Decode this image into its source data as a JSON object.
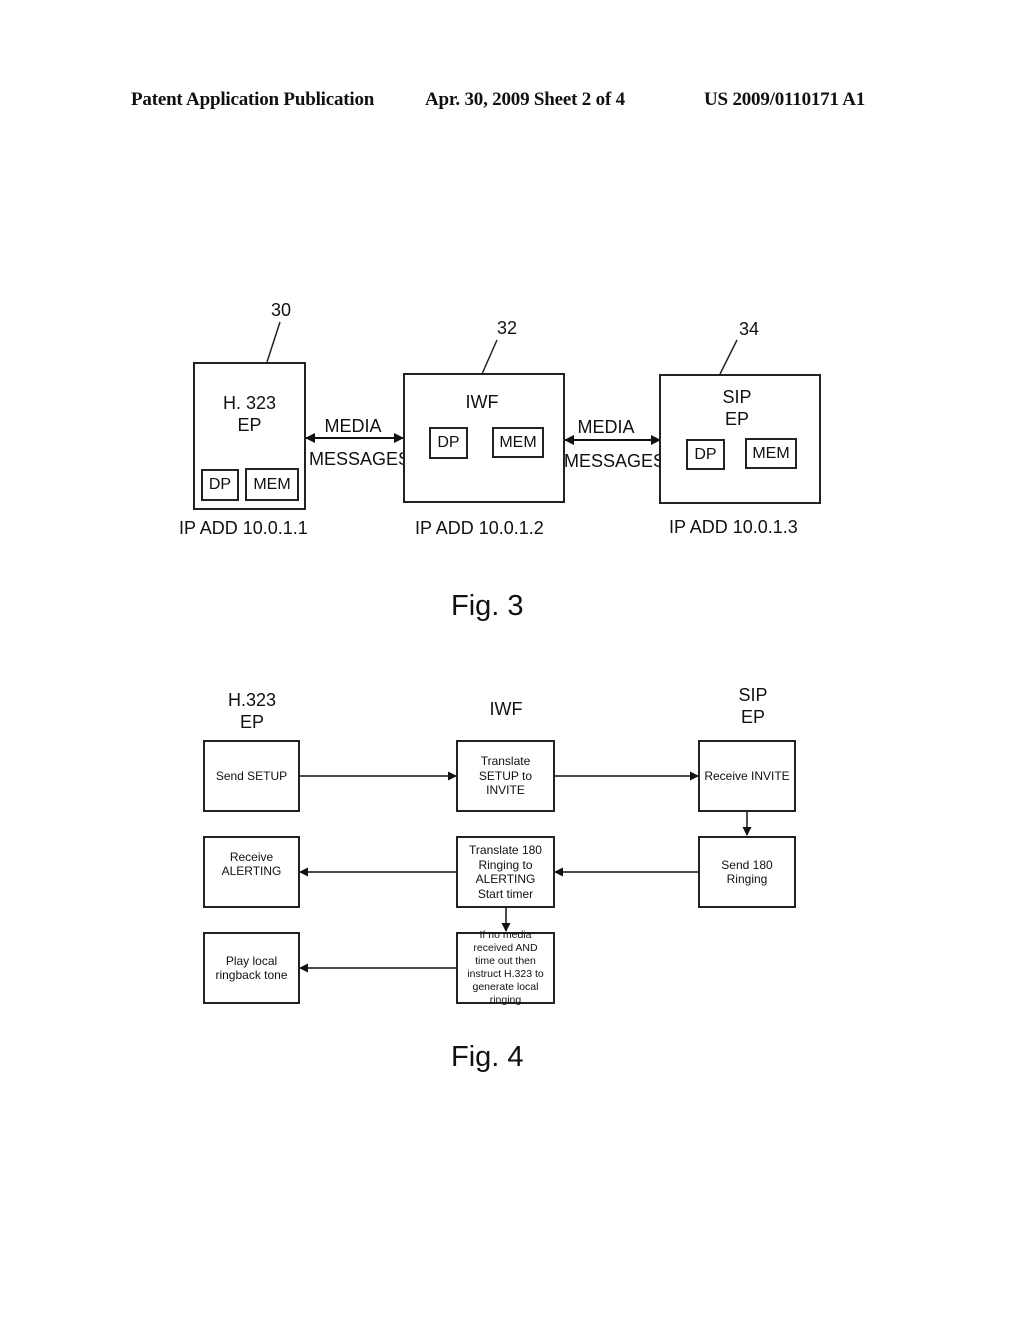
{
  "header": {
    "left": "Patent Application Publication",
    "center": "Apr. 30, 2009  Sheet 2 of 4",
    "right": "US 2009/0110171 A1"
  },
  "fig3": {
    "caption": "Fig. 3",
    "nodes": [
      {
        "ref": "30",
        "title": "H. 323\nEP",
        "dp": "DP",
        "mem": "MEM",
        "ip": "IP ADD 10.0.1.1"
      },
      {
        "ref": "32",
        "title": "IWF",
        "dp": "DP",
        "mem": "MEM",
        "ip": "IP ADD 10.0.1.2"
      },
      {
        "ref": "34",
        "title": "SIP\nEP",
        "dp": "DP",
        "mem": "MEM",
        "ip": "IP ADD 10.0.1.3"
      }
    ],
    "links": [
      {
        "top": "MEDIA",
        "bottom": "MESSAGES"
      },
      {
        "top": "MEDIA",
        "bottom": "MESSAGES"
      }
    ]
  },
  "fig4": {
    "caption": "Fig. 4",
    "columns": [
      "H.323\nEP",
      "IWF",
      "SIP\nEP"
    ],
    "steps": {
      "send_setup": "Send SETUP",
      "translate_setup": "Translate\nSETUP to\nINVITE",
      "receive_invite": "Receive INVITE",
      "send_180": "Send 180\nRinging",
      "translate_180": "Translate 180\nRinging to\nALERTING\nStart timer",
      "receive_alerting": "Receive\nALERTING",
      "timeout_instruct": "If no media\nreceived AND\ntime out then\ninstruct H.323 to\ngenerate local\nringing",
      "play_ringback": "Play local\nringback tone"
    }
  }
}
